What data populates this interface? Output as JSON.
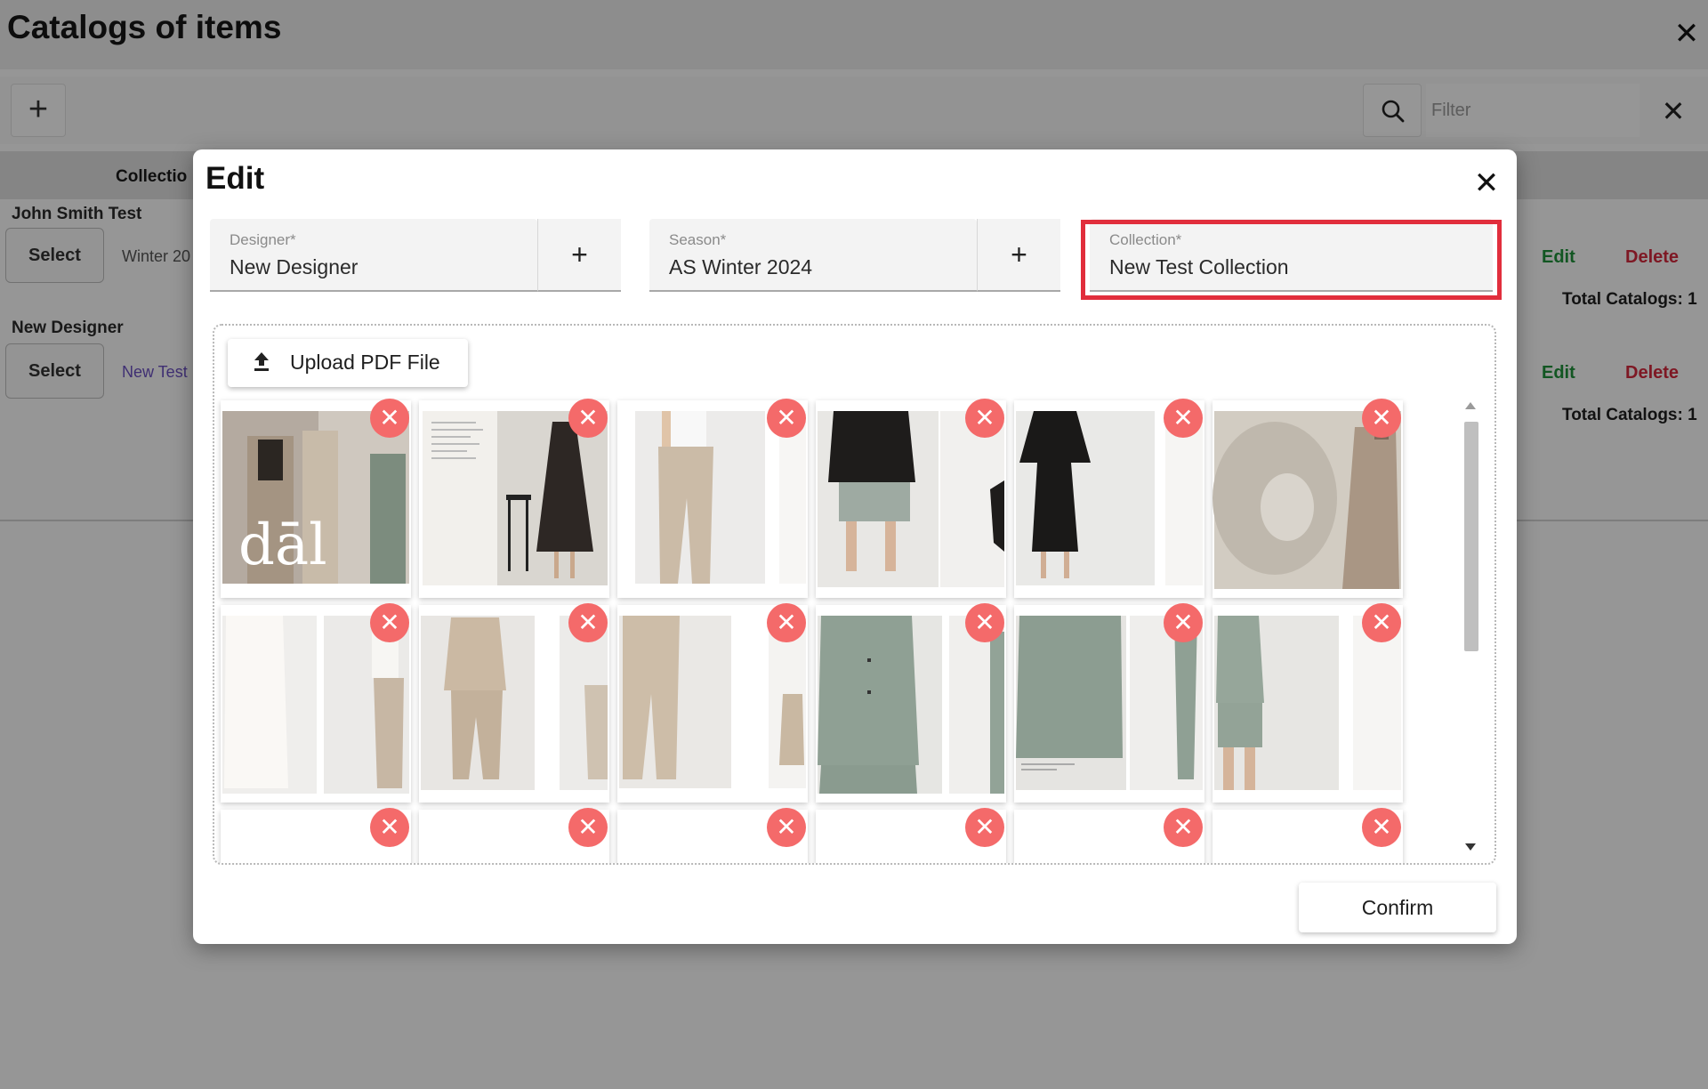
{
  "page": {
    "title": "Catalogs of items",
    "filter_placeholder": "Filter",
    "column_header": "Collectio",
    "groups": [
      {
        "name": "John Smith Test",
        "select_label": "Select",
        "season": "Winter 20",
        "edit_label": "Edit",
        "delete_label": "Delete",
        "total": "Total Catalogs: 1"
      },
      {
        "name": "New Designer",
        "select_label": "Select",
        "season": "New Test",
        "edit_label": "Edit",
        "delete_label": "Delete",
        "total": "Total Catalogs: 1"
      }
    ]
  },
  "modal": {
    "title": "Edit",
    "designer": {
      "label": "Designer*",
      "value": "New Designer"
    },
    "season": {
      "label": "Season*",
      "value": "AS Winter 2024"
    },
    "collection": {
      "label": "Collection*",
      "value": "New Test Collection"
    },
    "upload_label": "Upload PDF File",
    "confirm_label": "Confirm",
    "pages": [
      {
        "icon": "catalog-page-cover"
      },
      {
        "icon": "catalog-page-black-dress"
      },
      {
        "icon": "catalog-page-beige-trousers"
      },
      {
        "icon": "catalog-page-black-shirt-shorts"
      },
      {
        "icon": "catalog-page-black-dress-2"
      },
      {
        "icon": "catalog-page-beige-blazer"
      },
      {
        "icon": "catalog-page-white-shirt"
      },
      {
        "icon": "catalog-page-beige-suit"
      },
      {
        "icon": "catalog-page-beige-wide-trousers"
      },
      {
        "icon": "catalog-page-sage-blazer"
      },
      {
        "icon": "catalog-page-sage-trousers"
      },
      {
        "icon": "catalog-page-sage-shorts-suit"
      },
      {
        "icon": "catalog-page-blank"
      },
      {
        "icon": "catalog-page-blank"
      },
      {
        "icon": "catalog-page-blank"
      },
      {
        "icon": "catalog-page-blank"
      },
      {
        "icon": "catalog-page-blank"
      },
      {
        "icon": "catalog-page-blank"
      }
    ],
    "colors": {
      "highlight": "#e12e3c",
      "remove_button": "#f46a6a",
      "edit_link": "#1f8f3a",
      "delete_link": "#d3283c"
    }
  }
}
